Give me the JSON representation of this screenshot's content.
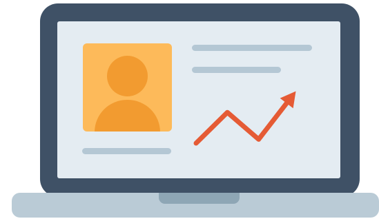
{
  "illustration": {
    "subject": "",
    "colors": {
      "frame": "#3f5166",
      "screen": "#e4ecf2",
      "avatar_card": "#fdba5a",
      "avatar_figure": "#f29b30",
      "text_lines": "#b4c7d4",
      "trend_line": "#e55b35",
      "base": "#bacbd6",
      "base_notch": "#8ea6b5"
    },
    "icons": {
      "profile": "user-avatar-icon",
      "trend": "trend-up-arrow-icon"
    },
    "trend_points": [
      [
        0,
        0
      ],
      [
        1,
        1.6
      ],
      [
        2,
        0.2
      ],
      [
        3,
        2.3
      ]
    ]
  }
}
